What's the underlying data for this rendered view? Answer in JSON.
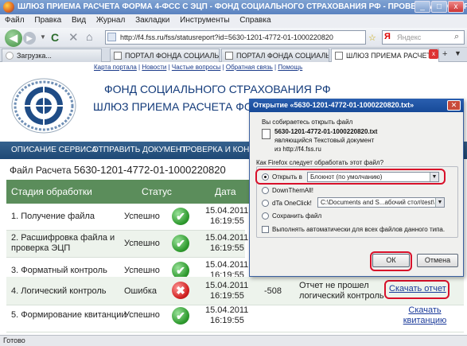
{
  "window": {
    "title": "ШЛЮЗ ПРИЕМА РАСЧЕТА ФОРМА 4-ФСС С ЭЦП - ФОНД СОЦИАЛЬНОГО СТРАХОВАНИЯ РФ - ПРОВЕРКА И КОНТРОЛЬ - Mozilla Firefox"
  },
  "menu": [
    "Файл",
    "Правка",
    "Вид",
    "Журнал",
    "Закладки",
    "Инструменты",
    "Справка"
  ],
  "address": {
    "url": "http://f4.fss.ru/fss/statusreport?id=5630-1201-4772-01-1000220820",
    "search_placeholder": "Яндекс"
  },
  "tabs": [
    {
      "label": "Загрузка..."
    },
    {
      "label": "ПОРТАЛ ФОНДА СОЦИАЛЬН..."
    },
    {
      "label": "ПОРТАЛ ФОНДА СОЦИАЛЬН..."
    },
    {
      "label": "ШЛЮЗ ПРИЕМА РАСЧЕТА..."
    }
  ],
  "header": {
    "links": [
      "Карта портала",
      "Новости",
      "Частые вопросы",
      "Обратная связь",
      "Помощь"
    ],
    "org_name": "ФОНД СОЦИАЛЬНОГО СТРАХОВАНИЯ РФ",
    "gateway_name": "ШЛЮЗ ПРИЕМА РАСЧЕТА ФОРМА 4-ФСС С ЭЦП"
  },
  "nav": [
    "ОПИСАНИЕ СЕРВИСА",
    "ОТПРАВИТЬ ДОКУМЕНТ",
    "ПРОВЕРКА И КОНТРОЛЬ"
  ],
  "report": {
    "file_label": "Файл Расчета",
    "file_id": "5630-1201-4772-01-1000220820",
    "columns": [
      "Стадия обработки",
      "Статус",
      "Дата"
    ],
    "rows": [
      {
        "stage": "1. Получение файла",
        "status": "Успешно",
        "date": "15.04.2011",
        "time": "16:19:55",
        "code": "",
        "message": "",
        "action": ""
      },
      {
        "stage": "2. Расшифровка файла и проверка ЭЦП",
        "status": "Успешно",
        "date": "15.04.2011",
        "time": "16:19:55",
        "code": "",
        "message": "",
        "action": ""
      },
      {
        "stage": "3. Форматный контроль",
        "status": "Успешно",
        "date": "15.04.2011",
        "time": "16:19:55",
        "code": "",
        "message": "",
        "action": ""
      },
      {
        "stage": "4. Логический контроль",
        "status": "Ошибка",
        "date": "15.04.2011",
        "time": "16:19:55",
        "code": "-508",
        "message": "Отчет не прошел логический контроль",
        "action": "Скачать отчет"
      },
      {
        "stage": "5. Формирование квитанции",
        "status": "Успешно",
        "date": "15.04.2011",
        "time": "16:19:55",
        "code": "",
        "message": "",
        "action": "Скачать квитанцию"
      }
    ]
  },
  "dialog": {
    "title": "Открытие «5630-1201-4772-01-1000220820.txt»",
    "intro": "Вы собираетесь открыть файл",
    "filename": "5630-1201-4772-01-1000220820.txt",
    "type_prefix": "являющийся",
    "type": "Текстовый документ",
    "source_prefix": "из",
    "source": "http://f4.fss.ru",
    "question": "Как Firefox следует обработать этот файл?",
    "open_with_label": "Открыть в",
    "open_with_value": "Блокнот (по умолчанию)",
    "downthemall": "DownThemAll!",
    "onetclick_label": "dTa OneClick!",
    "onetclick_path": "C:\\Documents and S...абочий стол\\test\\",
    "save_label": "Сохранить файл",
    "auto_label": "Выполнять автоматически для всех файлов данного типа.",
    "ok": "ОК",
    "cancel": "Отмена"
  },
  "status_bar": "Готово",
  "colors": {
    "table_header": "#5b8d5b",
    "nav_strip": "#1e4875",
    "highlight": "#d8102a"
  }
}
